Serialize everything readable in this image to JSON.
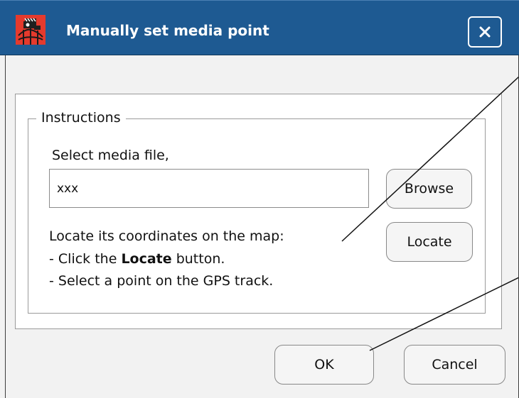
{
  "window": {
    "title": "Manually set media point"
  },
  "group": {
    "legend": "Instructions"
  },
  "media": {
    "label": "Select media file,",
    "value": "xxx"
  },
  "buttons": {
    "browse": "Browse",
    "locate": "Locate",
    "ok": "OK",
    "cancel": "Cancel"
  },
  "instructions": {
    "heading": "Locate its coordinates on the map:",
    "step1_prefix": "- Click the ",
    "step1_strong": "Locate",
    "step1_suffix": " button.",
    "step2": "- Select a point on the GPS track."
  },
  "colors": {
    "titlebar": "#1e5a92",
    "window": "#f2f2f2",
    "panel": "#ffffff"
  },
  "icons": {
    "app": "movie-camera-globe-icon",
    "close": "close-icon"
  }
}
